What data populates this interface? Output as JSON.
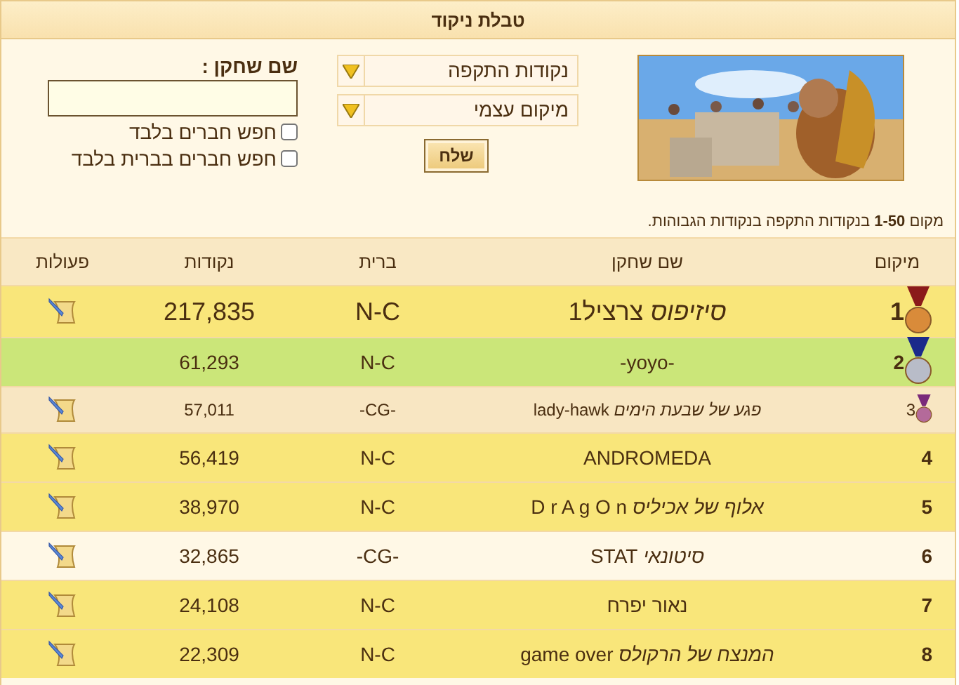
{
  "panel": {
    "title": "טבלת ניקוד"
  },
  "filters": {
    "selects": [
      {
        "value": "נקודות התקפה"
      },
      {
        "value": "מיקום עצמי"
      }
    ],
    "submit": "שלח",
    "name_label": "שם שחקן :",
    "checkboxes": [
      {
        "label": "חפש חברים בלבד",
        "checked": false
      },
      {
        "label": "חפש חברים בברית בלבד",
        "checked": false
      }
    ]
  },
  "summary": "מקום **1-50** בנקודות התקפה בנקודות הגבוהות.",
  "table": {
    "columns": [
      "מיקום",
      "שם שחקן",
      "ברית",
      "נקודות",
      "פעולות"
    ],
    "rows": [
      {
        "rank": "1",
        "player": "*סיזיפוס* צרציל1",
        "alliance": "N-C",
        "points": "217,835",
        "kind": "gold",
        "color": "#f9e67a",
        "has_action": true
      },
      {
        "rank": "2",
        "player": "-yoyo-",
        "alliance": "N-C",
        "points": "61,293",
        "kind": "silver",
        "color": "#cbe679",
        "has_action": false
      },
      {
        "rank": "3",
        "player": "*פגע של שבעת הימים* lady-hawk",
        "alliance": "-CG-",
        "points": "57,011",
        "kind": "bronze",
        "color": "#f8e6c2",
        "has_action": true
      },
      {
        "rank": "4",
        "player": "ANDROMEDA",
        "alliance": "N-C",
        "points": "56,419",
        "kind": "plain",
        "color": "#f9e67a",
        "has_action": true
      },
      {
        "rank": "5",
        "player": "*אלוף של אכיליס* D r A g O n",
        "alliance": "N-C",
        "points": "38,970",
        "kind": "plain",
        "color": "#f9e67a",
        "has_action": true
      },
      {
        "rank": "6",
        "player": "*סיטונאי* STAT",
        "alliance": "-CG-",
        "points": "32,865",
        "kind": "plain",
        "color": "#fff8e6",
        "has_action": true
      },
      {
        "rank": "7",
        "player": "נאור יפרח",
        "alliance": "N-C",
        "points": "24,108",
        "kind": "plain",
        "color": "#f9e67a",
        "has_action": true
      },
      {
        "rank": "8",
        "player": "*המנצח של הרקולס* game over",
        "alliance": "N-C",
        "points": "22,309",
        "kind": "plain",
        "color": "#f9e67a",
        "has_action": true
      }
    ]
  }
}
